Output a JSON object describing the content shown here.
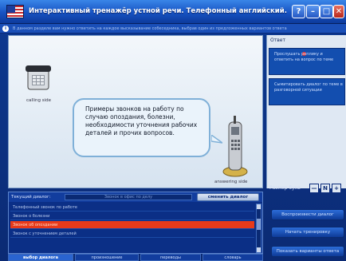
{
  "window": {
    "title": "Интерактивный тренажёр устной речи. Телефонный английский.",
    "help_label": "?",
    "minimize_label": "–",
    "maximize_label": "□",
    "close_label": "✕"
  },
  "hint": {
    "icon": "i",
    "text": "В данном разделе вам нужно ответить на каждое высказывание собеседника, выбрав один из предложенных вариантов ответа"
  },
  "scene": {
    "caller_label": "calling side",
    "receiver_label": "answering side",
    "bubble_text": "Примеры звонков на работу по случаю опоздания, болезни, необходимости уточнения рабочих деталей и прочих вопросов."
  },
  "options": {
    "title": "Ответ",
    "card1_text": "Прослушать реплику и ответить на вопрос по теме",
    "card2_text": "Сымитировать диалог по теме в разговорной ситуации"
  },
  "font_size": {
    "label": "Размер букв",
    "minus": "—",
    "normal": "N",
    "plus": "+"
  },
  "actions": {
    "btn1": "Воспроизвести диалог",
    "btn2": "Начать тренировку",
    "btn3": "Показать варианты ответа"
  },
  "dialog": {
    "current_label": "Текущий диалог:",
    "current_value": "Звонок в офис по делу",
    "change_btn": "сменить диалог",
    "items": [
      "Телефонный звонок по работе",
      "Звонок о болезни",
      "Звонок об опоздании",
      "Звонок с уточнением деталей"
    ]
  },
  "tabs": [
    "выбор диалога",
    "произношение",
    "переводы",
    "словарь"
  ]
}
